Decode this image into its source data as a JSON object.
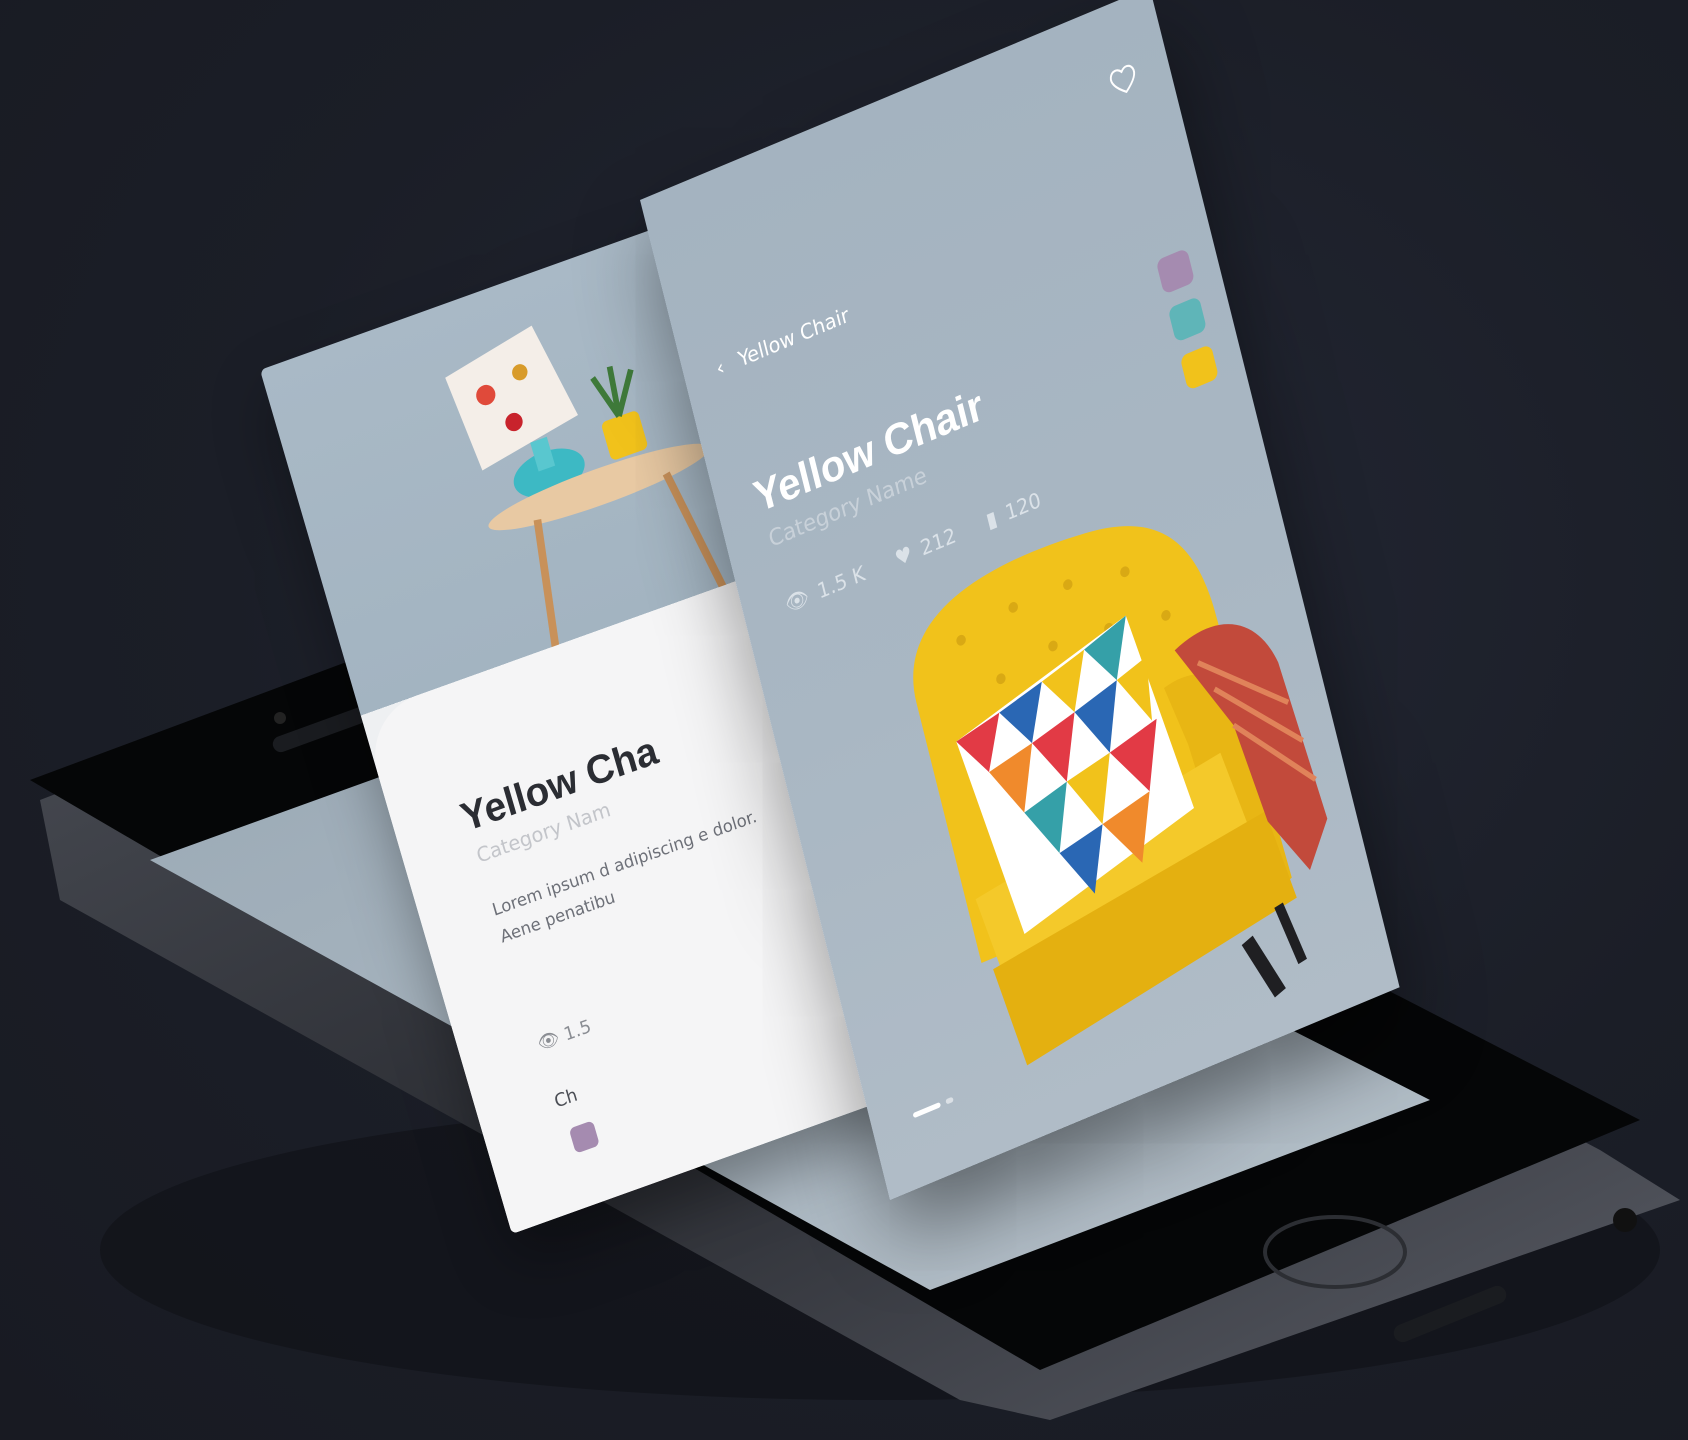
{
  "colors": {
    "background": "#1c1f29",
    "card": "#a4b3c0",
    "accent_yellow": "#f1c21b"
  },
  "front_card": {
    "back_label": "Yellow Chair",
    "title": "Yellow Chair",
    "category": "Category Name",
    "stats": {
      "views": "1.5 K",
      "likes": "212",
      "saves": "120"
    },
    "swatches": [
      "#a58bb0",
      "#5fb5b8",
      "#f1c21b"
    ],
    "icons": {
      "back": "chevron-left-icon",
      "favorite": "heart-icon",
      "views": "eye-icon",
      "likes": "heart-icon",
      "saves": "bookmark-icon"
    }
  },
  "back_card": {
    "title": "Yellow Cha",
    "category": "Category Nam",
    "lorem": "Lorem ipsum d adipiscing e dolor. Aene penatibu",
    "views": "1.5",
    "choose_label": "Ch"
  }
}
